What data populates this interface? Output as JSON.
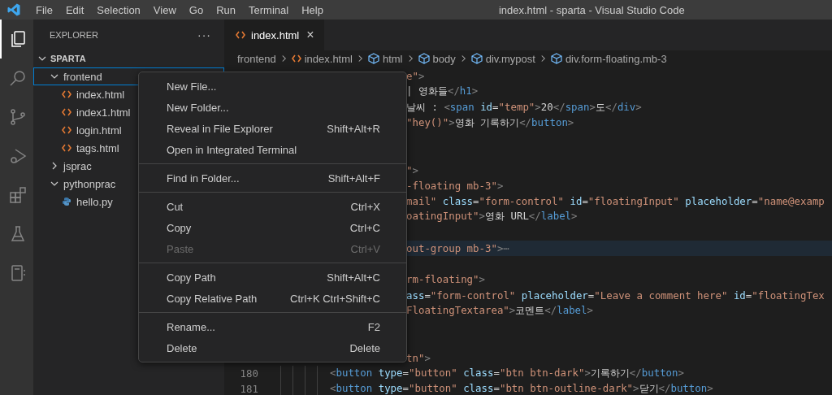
{
  "title_bar": {
    "menus": [
      "File",
      "Edit",
      "Selection",
      "View",
      "Go",
      "Run",
      "Terminal",
      "Help"
    ],
    "title": "index.html - sparta - Visual Studio Code"
  },
  "activity_bar": [
    {
      "kind": "files",
      "selected": true
    },
    {
      "kind": "search",
      "selected": false
    },
    {
      "kind": "source-control",
      "selected": false
    },
    {
      "kind": "run",
      "selected": false
    },
    {
      "kind": "extensions",
      "selected": false
    },
    {
      "kind": "testing",
      "selected": false
    },
    {
      "kind": "notebook",
      "selected": false
    }
  ],
  "sidebar": {
    "title": "EXPLORER",
    "more": "···",
    "root": {
      "label": "SPARTA",
      "expanded": true
    },
    "tree": [
      {
        "label": "frontend",
        "kind": "folder",
        "expanded": true,
        "focused": true,
        "children": [
          {
            "label": "index.html",
            "kind": "html",
            "focused": false
          },
          {
            "label": "index1.html",
            "kind": "html",
            "focused": false
          },
          {
            "label": "login.html",
            "kind": "html",
            "focused": false
          },
          {
            "label": "tags.html",
            "kind": "html",
            "focused": false
          }
        ]
      },
      {
        "label": "jsprac",
        "kind": "folder",
        "expanded": false,
        "focused": false
      },
      {
        "label": "pythonprac",
        "kind": "folder",
        "expanded": true,
        "focused": false,
        "children": [
          {
            "label": "hello.py",
            "kind": "python",
            "focused": false
          }
        ]
      }
    ]
  },
  "tabs": [
    {
      "label": "index.html",
      "selected": true,
      "close": "×"
    }
  ],
  "breadcrumbs": [
    {
      "label": "frontend",
      "kind": "folder"
    },
    {
      "label": "index.html",
      "kind": "file"
    },
    {
      "label": "html",
      "kind": "element"
    },
    {
      "label": "body",
      "kind": "element"
    },
    {
      "label": "div.mypost",
      "kind": "element"
    },
    {
      "label": "div.form-floating.mb-3",
      "kind": "element"
    }
  ],
  "code_lines": [
    {
      "kind": "partial",
      "highlighted": false,
      "tokens": [
        {
          "kind": "str",
          "t": "e\""
        },
        {
          "kind": "punct",
          "t": ">"
        }
      ]
    },
    {
      "kind": "partial",
      "highlighted": false,
      "tokens": [
        {
          "kind": "text",
          "t": "| 영화들"
        },
        {
          "kind": "punct",
          "t": "</"
        },
        {
          "kind": "tag",
          "t": "h1"
        },
        {
          "kind": "punct",
          "t": ">"
        }
      ]
    },
    {
      "kind": "partial",
      "highlighted": false,
      "tokens": [
        {
          "kind": "text",
          "t": "날씨 : "
        },
        {
          "kind": "punct",
          "t": "<"
        },
        {
          "kind": "tag",
          "t": "span"
        },
        {
          "kind": "attr",
          "t": " id"
        },
        {
          "kind": "text",
          "t": "="
        },
        {
          "kind": "str",
          "t": "\"temp\""
        },
        {
          "kind": "punct",
          "t": ">"
        },
        {
          "kind": "text",
          "t": "20"
        },
        {
          "kind": "punct",
          "t": "</"
        },
        {
          "kind": "tag",
          "t": "span"
        },
        {
          "kind": "punct",
          "t": ">"
        },
        {
          "kind": "text",
          "t": "도"
        },
        {
          "kind": "punct",
          "t": "</"
        },
        {
          "kind": "tag",
          "t": "div"
        },
        {
          "kind": "punct",
          "t": ">"
        }
      ]
    },
    {
      "kind": "partial",
      "highlighted": false,
      "tokens": [
        {
          "kind": "str",
          "t": "\"hey()\""
        },
        {
          "kind": "punct",
          "t": ">"
        },
        {
          "kind": "text",
          "t": "영화 기록하기"
        },
        {
          "kind": "punct",
          "t": "</"
        },
        {
          "kind": "tag",
          "t": "button"
        },
        {
          "kind": "punct",
          "t": ">"
        }
      ]
    },
    {
      "kind": "blank",
      "highlighted": false
    },
    {
      "kind": "blank",
      "highlighted": false
    },
    {
      "kind": "partial",
      "highlighted": false,
      "tokens": [
        {
          "kind": "str",
          "t": "\""
        },
        {
          "kind": "punct",
          "t": ">"
        }
      ]
    },
    {
      "kind": "partial",
      "highlighted": false,
      "tokens": [
        {
          "kind": "str",
          "t": "-floating mb-3\""
        },
        {
          "kind": "punct",
          "t": ">"
        }
      ]
    },
    {
      "kind": "partial",
      "highlighted": false,
      "tokens": [
        {
          "kind": "str",
          "t": "mail\""
        },
        {
          "kind": "attr",
          "t": " class"
        },
        {
          "kind": "text",
          "t": "="
        },
        {
          "kind": "str",
          "t": "\"form-control\""
        },
        {
          "kind": "attr",
          "t": " id"
        },
        {
          "kind": "text",
          "t": "="
        },
        {
          "kind": "str",
          "t": "\"floatingInput\""
        },
        {
          "kind": "attr",
          "t": " placeholder"
        },
        {
          "kind": "text",
          "t": "="
        },
        {
          "kind": "str",
          "t": "\"name@examp"
        }
      ]
    },
    {
      "kind": "partial",
      "highlighted": false,
      "tokens": [
        {
          "kind": "str",
          "t": "oatingInput\""
        },
        {
          "kind": "punct",
          "t": ">"
        },
        {
          "kind": "text",
          "t": "영화 URL"
        },
        {
          "kind": "punct",
          "t": "</"
        },
        {
          "kind": "tag",
          "t": "label"
        },
        {
          "kind": "punct",
          "t": ">"
        }
      ]
    },
    {
      "kind": "blank",
      "highlighted": false
    },
    {
      "kind": "partial",
      "highlighted": true,
      "tokens": [
        {
          "kind": "str",
          "t": "out-group mb-3\""
        },
        {
          "kind": "punct",
          "t": ">⋯"
        }
      ]
    },
    {
      "kind": "blank",
      "highlighted": false
    },
    {
      "kind": "partial",
      "highlighted": false,
      "tokens": [
        {
          "kind": "str",
          "t": "rm-floating\""
        },
        {
          "kind": "punct",
          "t": ">"
        }
      ]
    },
    {
      "kind": "partial",
      "highlighted": false,
      "tokens": [
        {
          "kind": "attr",
          "t": "ass"
        },
        {
          "kind": "text",
          "t": "="
        },
        {
          "kind": "str",
          "t": "\"form-control\""
        },
        {
          "kind": "attr",
          "t": " placeholder"
        },
        {
          "kind": "text",
          "t": "="
        },
        {
          "kind": "str",
          "t": "\"Leave a comment here\""
        },
        {
          "kind": "attr",
          "t": " id"
        },
        {
          "kind": "text",
          "t": "="
        },
        {
          "kind": "str",
          "t": "\"floatingTex"
        }
      ]
    },
    {
      "kind": "partial",
      "highlighted": false,
      "tokens": [
        {
          "kind": "str",
          "t": "FloatingTextarea\""
        },
        {
          "kind": "punct",
          "t": ">"
        },
        {
          "kind": "text",
          "t": "코멘트"
        },
        {
          "kind": "punct",
          "t": "</"
        },
        {
          "kind": "tag",
          "t": "label"
        },
        {
          "kind": "punct",
          "t": ">"
        }
      ]
    },
    {
      "kind": "blank",
      "highlighted": false
    },
    {
      "kind": "blank",
      "highlighted": false
    },
    {
      "kind": "partial",
      "highlighted": false,
      "tokens": [
        {
          "kind": "str",
          "t": "tn\""
        },
        {
          "kind": "punct",
          "t": ">"
        }
      ]
    },
    {
      "kind": "full",
      "number": "180",
      "highlighted": false,
      "tokens": [
        {
          "kind": "punct",
          "t": "<"
        },
        {
          "kind": "tag",
          "t": "button"
        },
        {
          "kind": "attr",
          "t": " type"
        },
        {
          "kind": "text",
          "t": "="
        },
        {
          "kind": "str",
          "t": "\"button\""
        },
        {
          "kind": "attr",
          "t": " class"
        },
        {
          "kind": "text",
          "t": "="
        },
        {
          "kind": "str",
          "t": "\"btn btn-dark\""
        },
        {
          "kind": "punct",
          "t": ">"
        },
        {
          "kind": "text",
          "t": "기록하기"
        },
        {
          "kind": "punct",
          "t": "</"
        },
        {
          "kind": "tag",
          "t": "button"
        },
        {
          "kind": "punct",
          "t": ">"
        }
      ]
    },
    {
      "kind": "full",
      "number": "181",
      "highlighted": false,
      "tokens": [
        {
          "kind": "punct",
          "t": "<"
        },
        {
          "kind": "tag",
          "t": "button"
        },
        {
          "kind": "attr",
          "t": " type"
        },
        {
          "kind": "text",
          "t": "="
        },
        {
          "kind": "str",
          "t": "\"button\""
        },
        {
          "kind": "attr",
          "t": " class"
        },
        {
          "kind": "text",
          "t": "="
        },
        {
          "kind": "str",
          "t": "\"btn btn-outline-dark\""
        },
        {
          "kind": "punct",
          "t": ">"
        },
        {
          "kind": "text",
          "t": "닫기"
        },
        {
          "kind": "punct",
          "t": "</"
        },
        {
          "kind": "tag",
          "t": "button"
        },
        {
          "kind": "punct",
          "t": ">"
        }
      ]
    }
  ],
  "context_menu": [
    [
      {
        "label": "New File...",
        "disabled": false
      },
      {
        "label": "New Folder...",
        "disabled": false
      },
      {
        "label": "Reveal in File Explorer",
        "shortcut": "Shift+Alt+R",
        "disabled": false
      },
      {
        "label": "Open in Integrated Terminal",
        "disabled": false
      }
    ],
    [
      {
        "label": "Find in Folder...",
        "shortcut": "Shift+Alt+F",
        "disabled": false
      }
    ],
    [
      {
        "label": "Cut",
        "shortcut": "Ctrl+X",
        "disabled": false
      },
      {
        "label": "Copy",
        "shortcut": "Ctrl+C",
        "disabled": false
      },
      {
        "label": "Paste",
        "shortcut": "Ctrl+V",
        "disabled": true
      }
    ],
    [
      {
        "label": "Copy Path",
        "shortcut": "Shift+Alt+C",
        "disabled": false
      },
      {
        "label": "Copy Relative Path",
        "shortcut": "Ctrl+K Ctrl+Shift+C",
        "disabled": false
      }
    ],
    [
      {
        "label": "Rename...",
        "shortcut": "F2",
        "disabled": false
      },
      {
        "label": "Delete",
        "shortcut": "Delete",
        "disabled": false
      }
    ]
  ]
}
